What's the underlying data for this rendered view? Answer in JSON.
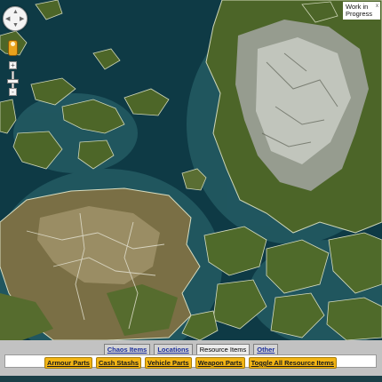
{
  "map": {
    "type": "satellite-style game world map",
    "water": "#0e3a45",
    "land": "#4f6a2a",
    "mountain": "#b9bcb5"
  },
  "controls": {
    "pan_icon": "pan-control-icon",
    "pegman_icon": "street-view-pegman-icon",
    "zoom_in_label": "+",
    "zoom_out_label": "-"
  },
  "notice": {
    "text": "Work in Progress",
    "close_label": "x"
  },
  "tabs": [
    {
      "label": "Chaos Items",
      "active": false
    },
    {
      "label": "Locations",
      "active": false
    },
    {
      "label": "Resource Items",
      "active": true
    },
    {
      "label": "Other",
      "active": false
    }
  ],
  "resource_buttons": [
    {
      "label": "Armour Parts"
    },
    {
      "label": "Cash Stashs"
    },
    {
      "label": "Vehicle Parts"
    },
    {
      "label": "Weapon Parts"
    },
    {
      "label": "Toggle All Resource Items"
    }
  ],
  "colors": {
    "button": "#f2b413",
    "panel": "#c2c2c2",
    "tab_link": "#1c2f9c"
  }
}
